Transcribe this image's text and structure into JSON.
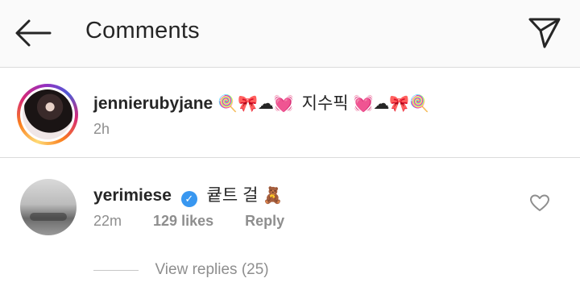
{
  "header": {
    "title": "Comments",
    "back_icon": "arrow-left-icon",
    "share_icon": "paper-plane-icon"
  },
  "caption": {
    "username": "jennierubyjane",
    "emojis_before": "🍭🎀☁💓",
    "text": "지수픽",
    "emojis_after": "💓☁🎀🍭",
    "time": "2h"
  },
  "comment": {
    "username": "yerimiese",
    "verified_icon": "verified-badge-icon",
    "text": "큩트 걸",
    "emoji": "🧸",
    "time": "22m",
    "likes": "129 likes",
    "reply_label": "Reply",
    "like_icon": "heart-outline-icon",
    "view_replies": "View replies (25)"
  },
  "colors": {
    "header_bg": "#fafafa",
    "text_primary": "#262626",
    "text_secondary": "#8e8e8e",
    "verified_blue": "#3897f0",
    "divider": "#dbdbdb"
  }
}
